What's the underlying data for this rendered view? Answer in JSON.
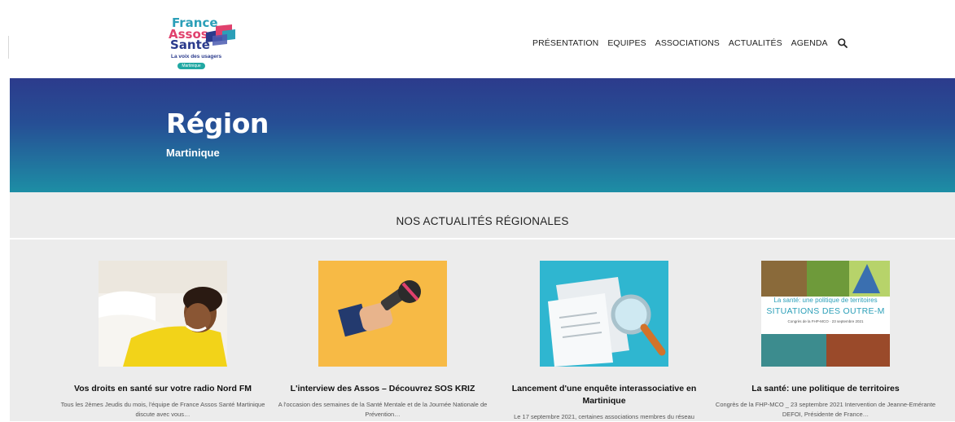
{
  "logo": {
    "line1": "France",
    "line2": "Assos",
    "line3": "Santé",
    "tagline": "La voix des usagers",
    "badge": "Martinique"
  },
  "nav": {
    "items": [
      "PRÉSENTATION",
      "EQUIPES",
      "ASSOCIATIONS",
      "ACTUALITÉS",
      "AGENDA"
    ],
    "search_icon": "search-icon"
  },
  "hero": {
    "title": "Région",
    "subtitle": "Martinique"
  },
  "section": {
    "heading": "NOS ACTUALITÉS RÉGIONALES"
  },
  "cards": [
    {
      "title": "Vos droits en santé sur votre radio Nord FM",
      "excerpt": "Tous les 2èmes Jeudis du mois, l'équipe de France Assos Santé Martinique discute avec vous…"
    },
    {
      "title": "L'interview des Assos – Découvrez SOS KRIZ",
      "excerpt": "A l'occasion des semaines de la Santé Mentale et de la Journée Nationale de Prévention…"
    },
    {
      "title": "Lancement d'une enquête interassociative en Martinique",
      "excerpt": "Le 17 septembre 2021, certaines associations membres du réseau"
    },
    {
      "title": "La santé: une politique de territoires",
      "excerpt": "Congrès de la FHP-MCO _ 23 septembre 2021 Intervention de Jeanne-Emérante DEFOI, Présidente de France…",
      "image_text": {
        "line1": "La santé: une politique de territoires",
        "line2": "SITUATIONS DES OUTRE-M",
        "line3": "Congrès de la FHP-MCO · 23 septembre 2021"
      }
    }
  ],
  "colors": {
    "hero_top": "#2c3b8c",
    "hero_bottom": "#1d8ea5",
    "section_bg": "#ececec",
    "brand_teal": "#2b9fb8",
    "brand_pink": "#e0416d",
    "brand_navy": "#2a3a8c"
  }
}
